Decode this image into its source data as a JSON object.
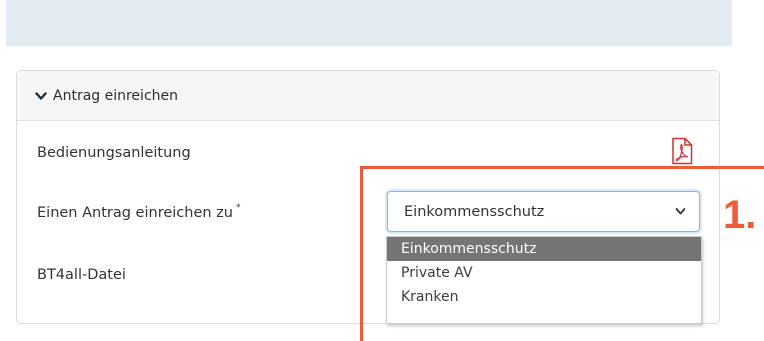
{
  "panel": {
    "title": "Antrag einreichen",
    "rows": [
      {
        "label": "Bedienungsanleitung",
        "icon": "pdf-icon"
      },
      {
        "label": "Einen Antrag einreichen zu",
        "required_mark": "*"
      },
      {
        "label": "BT4all-Datei"
      }
    ]
  },
  "select": {
    "value": "Einkommensschutz",
    "options": [
      "Einkommensschutz",
      "Private AV",
      "Kranken"
    ],
    "selected_index": 0
  },
  "annotation": {
    "label": "1.",
    "color": "#ee5a3a"
  },
  "colors": {
    "pdf_icon": "#d0312d",
    "top_band": "#e3ecf3",
    "selected_option_bg": "#757575"
  }
}
